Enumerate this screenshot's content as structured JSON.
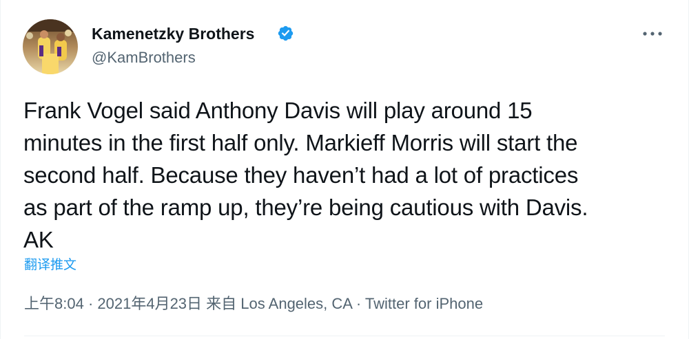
{
  "author": {
    "display_name": "Kamenetzky Brothers",
    "handle": "@KamBrothers",
    "verified_icon": "verified-badge-icon",
    "avatar_icon": "avatar-photo-basketball-players"
  },
  "more_icon": "more-options-icon",
  "tweet": {
    "text": "Frank Vogel said Anthony Davis will play around 15\nminutes in the first half only. Markieff Morris will start the\nsecond half. Because they haven’t had a lot of practices\nas part of the ramp up, they’re being cautious with Davis.\nAK",
    "translate_label": "翻译推文"
  },
  "meta": {
    "time": "上午8:04",
    "separator": " · ",
    "date": "2021年4月23日",
    "location": "来自 Los Angeles, CA",
    "source": "Twitter for iPhone"
  },
  "colors": {
    "text_primary": "#0f1419",
    "text_secondary": "#536471",
    "accent": "#1d9bf0"
  }
}
